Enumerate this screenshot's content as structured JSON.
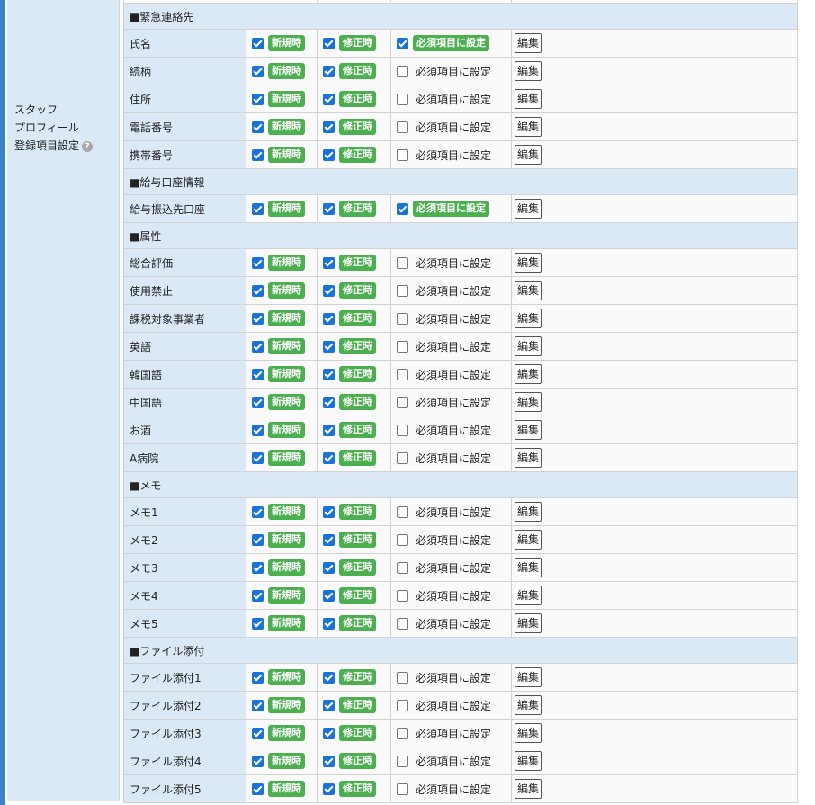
{
  "section_label": {
    "lines": [
      "スタッフ",
      "プロフィール",
      "登録項目設定"
    ]
  },
  "labels": {
    "new": "新規時",
    "edit": "修正時",
    "required": "必須項目に設定",
    "edit_button": "編集"
  },
  "groups": [
    {
      "title": "■緊急連絡先",
      "rows": [
        {
          "name": "氏名",
          "required": true
        },
        {
          "name": "続柄",
          "required": false
        },
        {
          "name": "住所",
          "required": false
        },
        {
          "name": "電話番号",
          "required": false
        },
        {
          "name": "携帯番号",
          "required": false
        }
      ]
    },
    {
      "title": "■給与口座情報",
      "rows": [
        {
          "name": "給与振込先口座",
          "required": true
        }
      ]
    },
    {
      "title": "■属性",
      "rows": [
        {
          "name": "総合評価",
          "required": false
        },
        {
          "name": "使用禁止",
          "required": false
        },
        {
          "name": "課税対象事業者",
          "required": false
        },
        {
          "name": "英語",
          "required": false
        },
        {
          "name": "韓国語",
          "required": false
        },
        {
          "name": "中国語",
          "required": false
        },
        {
          "name": "お酒",
          "required": false
        },
        {
          "name": "A病院",
          "required": false
        }
      ]
    },
    {
      "title": "■メモ",
      "rows": [
        {
          "name": "メモ1",
          "required": false
        },
        {
          "name": "メモ2",
          "required": false
        },
        {
          "name": "メモ3",
          "required": false
        },
        {
          "name": "メモ4",
          "required": false
        },
        {
          "name": "メモ5",
          "required": false
        }
      ]
    },
    {
      "title": "■ファイル添付",
      "rows": [
        {
          "name": "ファイル添付1",
          "required": false
        },
        {
          "name": "ファイル添付2",
          "required": false
        },
        {
          "name": "ファイル添付3",
          "required": false
        },
        {
          "name": "ファイル添付4",
          "required": false
        },
        {
          "name": "ファイル添付5",
          "required": false
        }
      ]
    }
  ],
  "colors": {
    "accent": "#3c83c6",
    "tag_green": "#4caf50",
    "checkbox_blue": "#1a73d9",
    "header_bg": "#dbe8f6"
  }
}
